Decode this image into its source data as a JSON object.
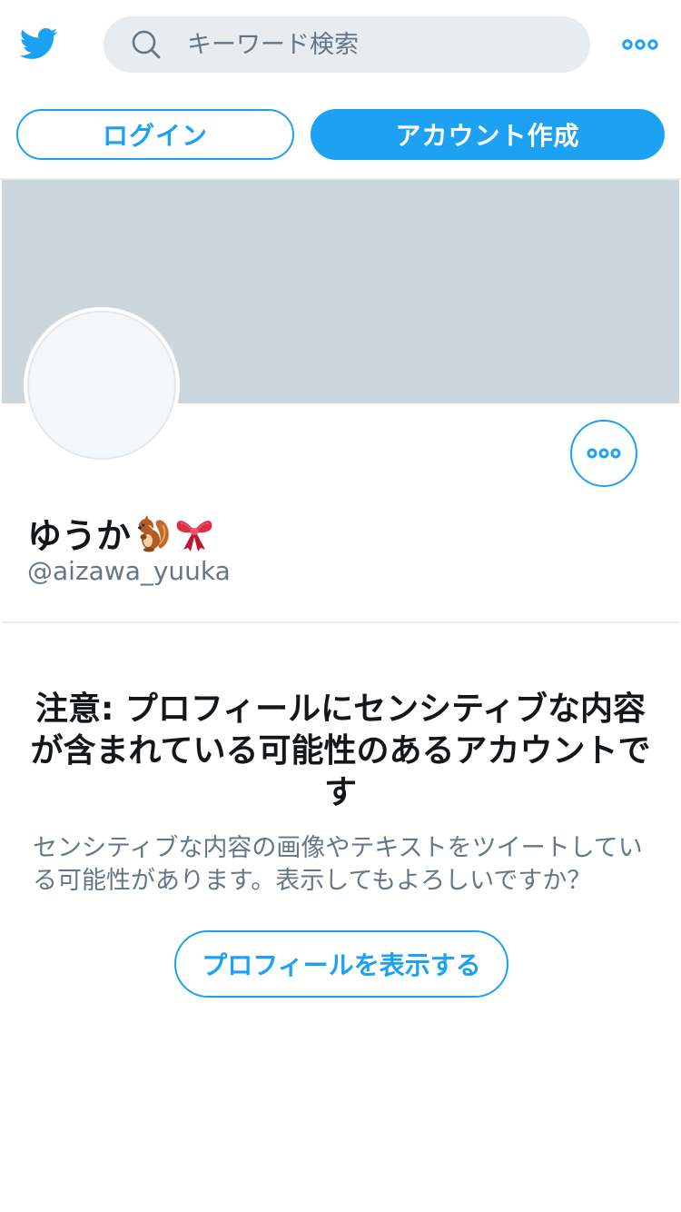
{
  "header": {
    "logo_icon": "twitter-bird-icon",
    "search": {
      "placeholder": "キーワード検索",
      "value": ""
    },
    "more_icon": "more-dots-icon"
  },
  "auth": {
    "login_label": "ログイン",
    "signup_label": "アカウント作成"
  },
  "profile": {
    "display_name": "ゆうか",
    "name_emojis": [
      "chipmunk-emoji-icon",
      "ribbon-emoji-icon"
    ],
    "handle": "@aizawa_yuuka",
    "more_icon": "more-dots-icon"
  },
  "sensitive_notice": {
    "title": "注意: プロフィールにセンシティブな内容が含まれている可能性のあるアカウントです",
    "body": "センシティブな内容の画像やテキストをツイートしている可能性があります。表示してもよろしいですか？",
    "view_profile_label": "プロフィールを表示する"
  },
  "colors": {
    "accent": "#1da1f2",
    "banner": "#ccd6dd",
    "search_bg": "#e6ecf0",
    "text_primary": "#14171a",
    "text_secondary": "#657786"
  }
}
